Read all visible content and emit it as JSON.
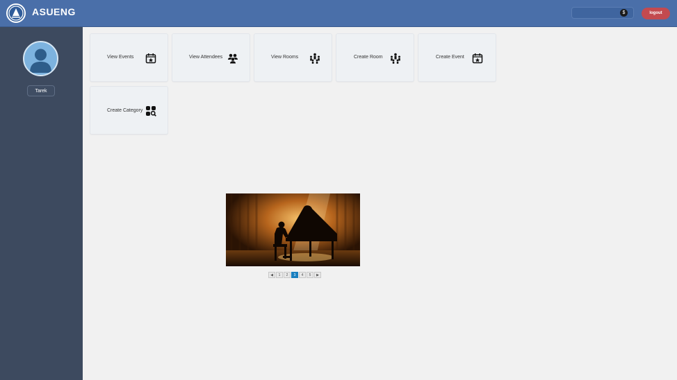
{
  "header": {
    "title": "ASUENG",
    "logo_icon": "university-seal-icon",
    "search": {
      "value": "",
      "placeholder": "",
      "icon": "search-dot-icon"
    },
    "logout_label": "logout"
  },
  "sidebar": {
    "avatar_icon": "user-avatar-icon",
    "username": "Tarek"
  },
  "actions": [
    {
      "label": "View Events",
      "icon": "calendar-star-icon"
    },
    {
      "label": "View Attendees",
      "icon": "people-group-icon"
    },
    {
      "label": "View Rooms",
      "icon": "room-seats-icon"
    },
    {
      "label": "Create Room",
      "icon": "room-seats-icon"
    },
    {
      "label": "Create Event",
      "icon": "calendar-star-icon"
    },
    {
      "label": "Create Category",
      "icon": "category-search-icon"
    }
  ],
  "gallery": {
    "image_subject": "pianist-silhouette-image",
    "pagination": {
      "prev": "◀",
      "pages": [
        "1",
        "2",
        "3",
        "4",
        "5"
      ],
      "current": "3",
      "next": "▶"
    }
  },
  "colors": {
    "header": "#4a6fa9",
    "sidebar": "#3d4a5f",
    "logout": "#c34a4f",
    "page_active": "#1a7fbf"
  }
}
